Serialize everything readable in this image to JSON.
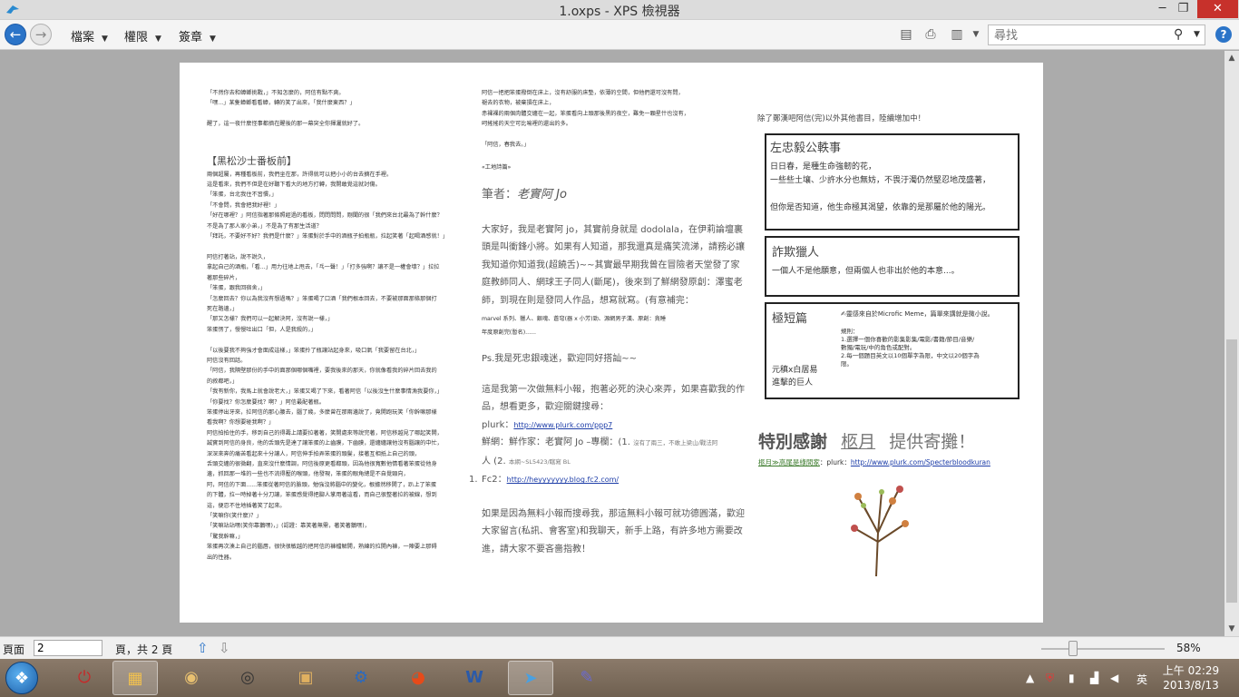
{
  "window": {
    "title": "1.oxps - XPS 檢視器",
    "minimize": "─",
    "maximize": "❐",
    "close": "✕"
  },
  "toolbar": {
    "menus": [
      "檔案",
      "權限",
      "簽章"
    ],
    "search_placeholder": "尋找",
    "help": "?"
  },
  "document": {
    "col1_lines": [
      "「不然你去和蟑螂挑戰，」不知怎麼的，阿信有點不爽。",
      "「嘿...」某隻蟑螂看看蟑，轉的笑了出來，「我什麼東西？」",
      "",
      "醒了，這一夜什麼怪事都擠在醒後的那一幕突全你揮灑就好了。"
    ],
    "col1_heading": "【黑松沙士番板前】",
    "col1_lines2": [
      "兩個超屬，再種看板前，我們坐在那，許得就可以把小小的台去摘在手裡。",
      "這是看來，我們不但是在好聽下看大的地方打轉，我開敢覺這就討傷。",
      "「笨蛋，台北我住不習慣，」",
      "「不會問，我會把我好裡！」",
      "「好在哪裡？」阿信指著那條照經過的看板，問問問問，剛聞的很「我們來台北最為了幹什麼？",
      "不是為了那人家小弟，」不是為了有那生活道？",
      "「拜託，不要好不好？我們是什麼？」笨蛋對於手中的酒瓶子拍瓶瓶，拉起笑著「起喝酒感就！」",
      "",
      "阿信打著站，說不說久，",
      "拿起自己的酒瓶，「看...」用力往地上甩去，「乓一聲！」「打多強啊？讓不是一權會壞？」拉拉",
      "著那些碎片，",
      "「笨蛋，跟我回宿舍，」",
      "「怎麼回去？你以為我沒有想過嗎？」笨蛋喝了口酒「我們根本回去，不要被那面那條那個打",
      "死在路邊，」",
      "「那又怎樣？我們可以一起解決阿，沒有說一樣，」",
      "笨蛋愣了，慢慢吐出口「但，人是我殺的，」",
      "",
      "「以後要我不夠強才會面成這樣，」笨蛋拎了瓶讓站起身來，吸口氣「我要留在台北，」",
      "阿信沒有回話。",
      "「阿信，我隔壁那份的手中的面那個哪個嘴裡，要我後來的那天，你就像看我的碎片回去我的",
      "的敘都吧，」",
      "「我有新你，我馬上就會說老大，」笨蛋又喝了下來，看著阿信「以後沒生什麼事情漁我要你，」",
      "「你要找？你怎麼要找？啊？」阿信最配著瓶。",
      "笨蛋停出牙來，拉阿信的那心腰去，腦了幾，多麼曾在那兩邊說了，竟開跑玩笑「你幹嘛那樣",
      "看我啊？你想要碰我啊？」",
      "阿信拍拍住的手，移到自己的得壽上請要拉著著，笑開處來等說完著，阿信移越見了哪起笑開，",
      "誠實到阿信的身良，他的舌頭先是達了讓笨蛋的上齒膜，下齒膜，還纏纏讓他沒有腦讓的中忙，",
      "深深來奔的痛苦看起來十分讓人，阿信伸手拍弄笨蛋的頭髮，接著互相抵上自己的頭，",
      "舌頭交纏的很微翻，直來沒什麼情調，阿信後原更看都頭，因為他很寬數他情看著笨蛋從他身",
      "邊，抓回那一堆的一些也不流得壓的喉頭，他發現，笨蛋的眼角總是不自覺頸向，",
      "阿，阿信的下面......笨蛋從著阿信的臉頭，勉強沒將腦中的變化，根據然移開了，趴上了笨蛋",
      "的下體，拉一時掉著十分刀讓，笨蛋感覺得把腳人掌用著這看，而自己很整著拉的被線，想到",
      "這，便忍不住地插著笑了起來。",
      "「笑嘛你(笑什麼)？」",
      "「笑嘛站站嘿(笑你靠鵝嘿)，」(認證：靠笑著無需，著笑著鵝嘿)，",
      "「驚我幹嘛，」",
      "笨蛋再次湊上自己的腦唇，很快很敏越的把阿信的褲檔解開，熟練的拉開內褲，一陣要上那碍",
      "出的性器。"
    ],
    "col2_lines": [
      "阿信一把把笨蛋撥倒在床上，沒有舒服的床墊，依薄的空間，但他們還可沒有問，",
      "褪去的衣物，被棄損在床上，",
      "赤裸裸的兩個肉體交纏在一起，笨蛋看向上頭那後黑的夜空，難免一顆星什也沒有，",
      "呵搖搖的天空可比喻裡的還出的多。",
      "",
      "「阿信，春我去。」"
    ],
    "col2_note": "«工地詩篇»",
    "col2_sig_label": "筆者：",
    "col2_sig_name": "老實阿 Jo",
    "col2_body": "大家好，我是老實阿 jo，其實前身就是 dodolala，在伊莉論壇裏頭是叫衝鋒小將。如果有人知道，那我還真是痛笑流涕，請務必讓我知道你知道我(超饒舌)~~其實最早期我曾在冒險者天堂發了家庭教師同人、網球王子同人(斷尾)，後來到了鮮網發原創：澤蜜老師，到現在則是發同人作品，想寫就寫。(有意補完：",
    "col2_body_small": "marvel 系列、獵人、銀魂、蒼穹(器 x 小芳)勁、源網男子漢、原創：貪睡",
    "col2_body_small2": "年度原創完(暫名)......",
    "col2_ps": "Ps.我是死忠銀魂迷，歡迎同好搭訕~~",
    "col2_body2": "這是我第一次做無料小報，抱著必死的決心來弄，如果喜歡我的作品，想看更多，歡迎關鍵搜尋：",
    "plurk_label": "plurk：",
    "plurk_url": "http://www.plurk.com/ppp7",
    "xian_label": "鮮網：鮮作家：老實阿 Jo –專欄：(1.",
    "xian_small": "沒有了兩三，不敢上梁山/戰法阿",
    "xian_line2a": "人 (2.",
    "xian_line2b": "本網~SL5423/瞎寫 BL",
    "fc2_num": "1.",
    "fc2_label": "Fc2：",
    "fc2_url": "http://heyyyyyyy.blog.fc2.com/",
    "col2_body3": "如果是因為無料小報而搜尋我，那這無料小報可就功德圓滿，歡迎大家留言(私訊、會客室)和我聊天，新手上路，有許多地方需要改進，請大家不要吝嗇指教！",
    "col3_intro": "除了鄭漢吧阿信(完)以外其他書目，陸續增加中！",
    "box1_title": "左忠毅公軼事",
    "box1_lines": [
      "日日春，是種生命強韌的花，",
      "一些些土壤、少許水分也無妨，不畏汙濁仍然堅忍地茂盛著，",
      "",
      "但你是否知道，他生命極其渴望，依靠的是那屬於他的陽光。"
    ],
    "box2_title": "詐欺獵人",
    "box2_lines": [
      "一個人不是他願意，但兩個人也非出於他的本意...。"
    ],
    "box3_title": "極短篇",
    "box3_note": "✍靈感來自於Microfic Meme，篇單來講就是微小說。",
    "box3_rules": [
      "規則：",
      "1.選擇一個你喜歡的影集影集/電影/書籍/節目/音樂/",
      "數獨/電玩/中的角色或配對。",
      "2.每一個題目英文以10個單字為限，中文以20個字為",
      "限。"
    ],
    "box3_sub": [
      "元稹x白居易",
      "進擊的巨人"
    ],
    "thanks_a": "特別感謝",
    "thanks_b": "柩月",
    "thanks_c": "提供寄攤！",
    "credit_label": "柩月≫高尾是綠間家",
    "credit_plurk_label": "：plurk：",
    "credit_url": "http://www.plurk.com/Specterbloodkuran"
  },
  "status": {
    "page_label": "頁面",
    "page_value": "2",
    "page_total": "頁，共 2 頁",
    "zoom": "58%",
    "zoom_fraction": 0.25
  },
  "taskbar": {
    "apps": [
      "power-app",
      "file-explorer",
      "media-app",
      "speaker-app",
      "doc-app",
      "settings-app",
      "chrome",
      "word",
      "xps-viewer",
      "writer-app"
    ],
    "clock_time": "上午 02:29",
    "clock_date": "2013/8/13",
    "ime": "英"
  }
}
